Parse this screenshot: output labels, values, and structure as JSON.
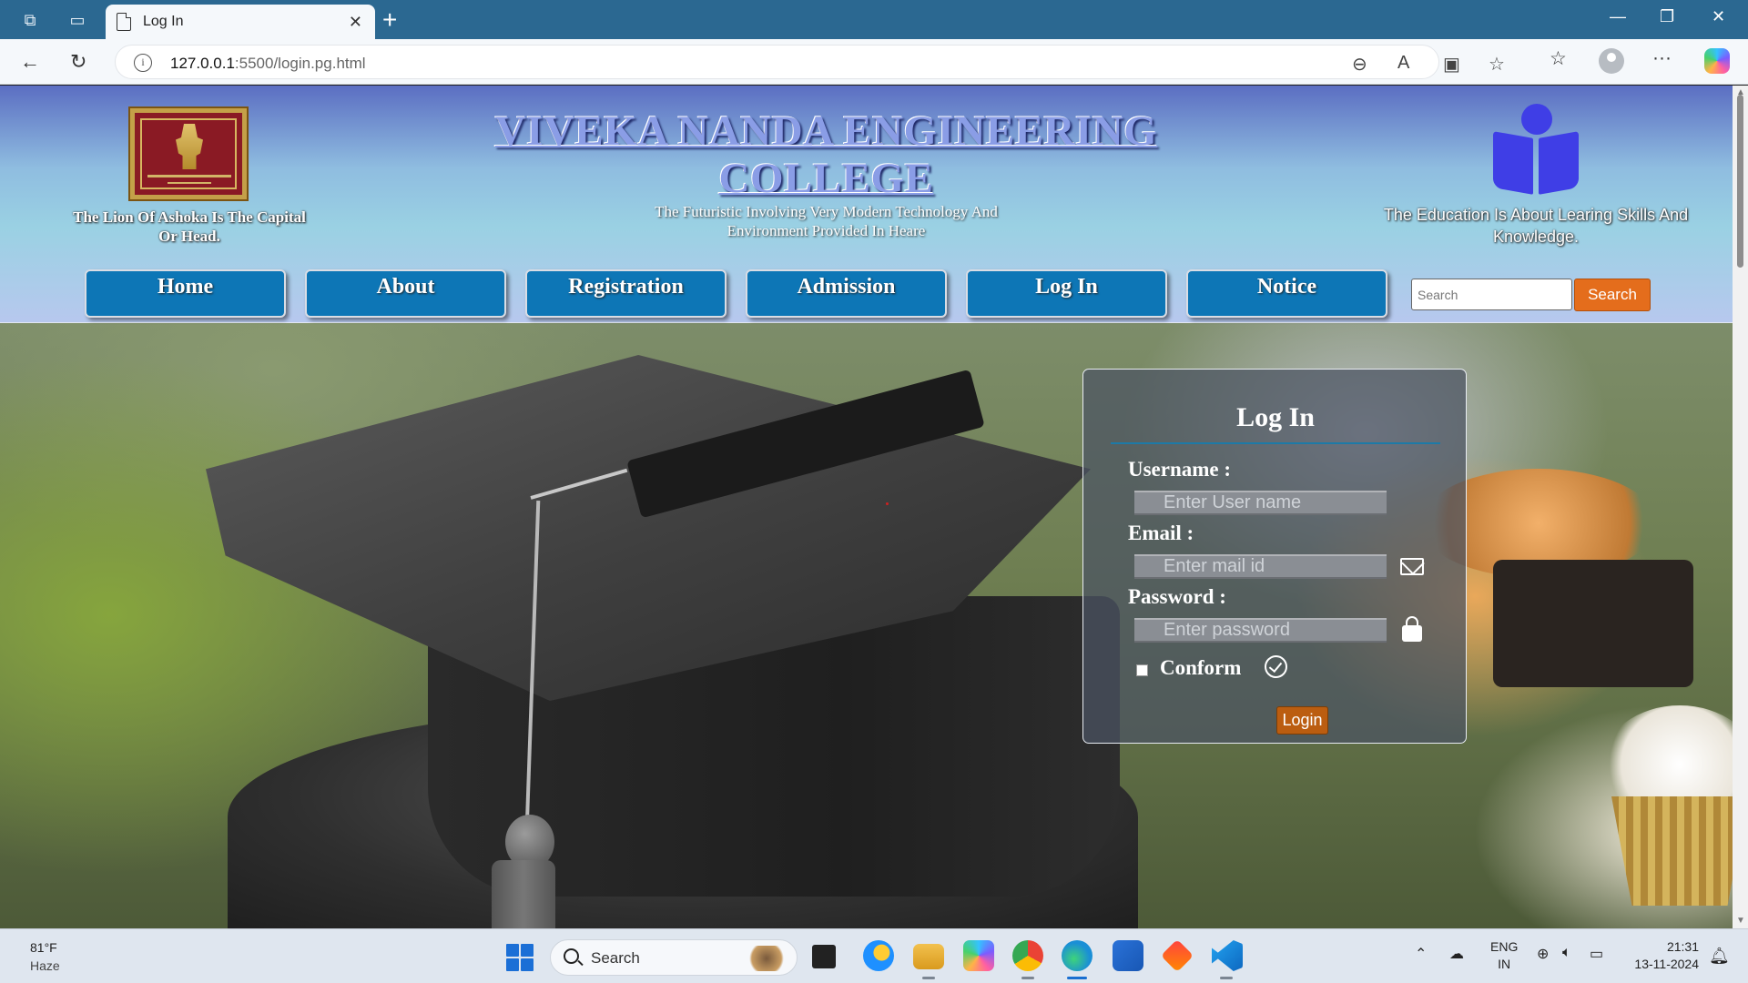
{
  "browser": {
    "tab_title": "Log In",
    "tab_close": "✕",
    "new_tab": "+",
    "url_host": "127.0.0.1",
    "url_rest": ":5500/login.pg.html",
    "info": "i"
  },
  "header": {
    "left_caption": "The Lion Of Ashoka Is The Capital Or Head.",
    "title": "VIVEKA NANDA ENGINEERING COLLEGE",
    "subtitle": "The Futuristic Involving Very Modern Technology And Environment Provided In Heare",
    "right_caption": "The Education Is About Learing Skills And Knowledge."
  },
  "nav": {
    "items": [
      "Home",
      "About",
      "Registration",
      "Admission",
      "Log In",
      "Notice"
    ],
    "search_placeholder": "Search",
    "search_button": "Search"
  },
  "login": {
    "title": "Log In",
    "username_label": "Username :",
    "username_placeholder": "Enter User name",
    "email_label": "Email :",
    "email_placeholder": "Enter mail id",
    "password_label": "Password :",
    "password_placeholder": "Enter password",
    "conform_label": "Conform",
    "login_button": "Login"
  },
  "taskbar": {
    "temperature": "81°F",
    "weather": "Haze",
    "search": "Search",
    "lang_1": "ENG",
    "lang_2": "IN",
    "time": "21:31",
    "date": "13-11-2024"
  },
  "colors": {
    "nav_button": "#0d76b6",
    "search_button": "#e46d1c",
    "login_button": "#bb5d10",
    "title_blue": "#8a9de6"
  }
}
